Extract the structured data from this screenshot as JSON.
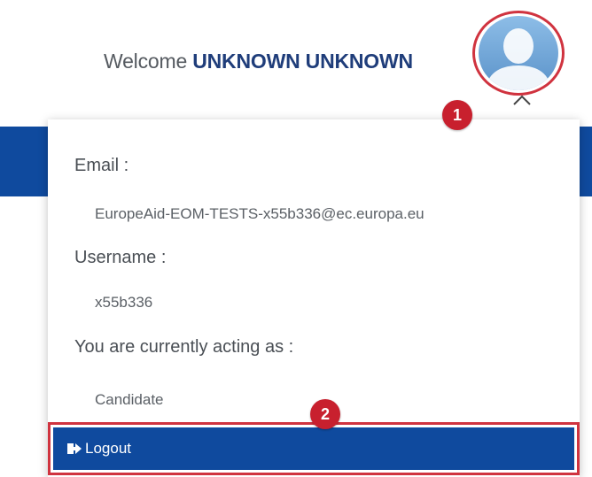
{
  "header": {
    "welcome_prefix": "Welcome ",
    "user_name": "UNKNOWN UNKNOWN"
  },
  "annotations": {
    "badge_1": "1",
    "badge_2": "2"
  },
  "profile_menu": {
    "email_label": "Email :",
    "email_value": "EuropeAid-EOM-TESTS-x55b336@ec.europa.eu",
    "username_label": "Username :",
    "username_value": "x55b336",
    "acting_label": "You are currently acting as :",
    "acting_value": "Candidate",
    "logout_label": "Logout"
  },
  "colors": {
    "brand_blue": "#0f4a9e",
    "annotation_red": "#c8202e",
    "user_name_blue": "#1f3d7a"
  },
  "icons": {
    "avatar": "user-silhouette-icon",
    "dropdown": "chevron-down-icon",
    "logout": "sign-out-icon"
  }
}
